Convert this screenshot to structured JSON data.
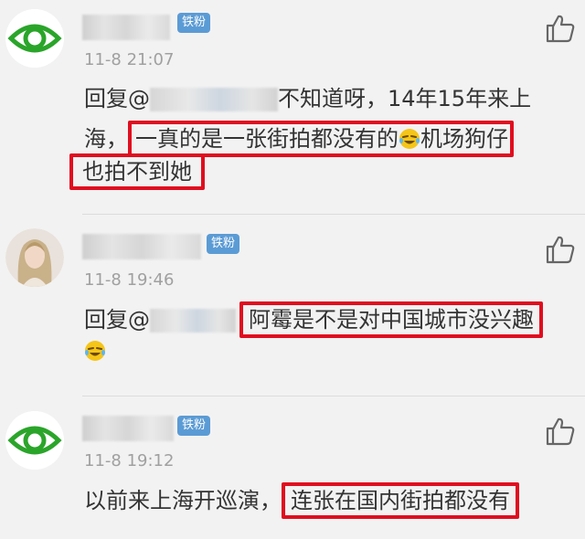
{
  "comments": [
    {
      "avatar_icon": "eye-icon",
      "badge": "铁粉",
      "time": "11-8 21:07",
      "reply_prefix": "回复@",
      "line1_rest": "不知道呀，14年15年来上",
      "line2_prefix": "海，",
      "hl1": "一真的是一张街拍都没有的",
      "hl1_after_emoji": "机场狗仔",
      "hl2": "也拍不到她"
    },
    {
      "avatar_icon": "user-avatar",
      "badge": "铁粉",
      "time": "11-8 19:46",
      "reply_prefix": "回复@",
      "hl": "阿霉是不是对中国城市没兴趣",
      "emoji": "laughing-crying-emoji"
    },
    {
      "avatar_icon": "eye-icon",
      "badge": "铁粉",
      "time": "11-8 19:12",
      "text_prefix": "以前来上海开巡演，",
      "hl": "连张在国内街拍都没有"
    }
  ],
  "colors": {
    "highlight": "#e00d1f",
    "eye_green": "#2aa52a",
    "badge": "#5b9bd5"
  }
}
